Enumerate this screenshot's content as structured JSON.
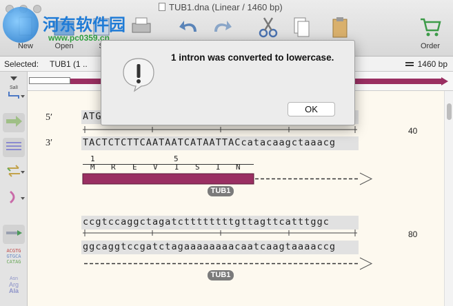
{
  "window": {
    "title": "TUB1.dna  (Linear / 1460 bp)"
  },
  "watermark": {
    "text": "河东软件园",
    "url": "www.pc0359.cn"
  },
  "toolbar": {
    "new_label": "New",
    "open_label": "Open",
    "save_label": "S",
    "order_label": "Order"
  },
  "selection": {
    "label": "Selected:",
    "value": "TUB1   (1 ..",
    "length": "1460 bp"
  },
  "sidebar": {
    "enzyme_label": "SalI",
    "seq_icon_lines": [
      "ACGTG",
      "GTGCA",
      "CATAG"
    ],
    "aa_icon_lines": [
      "Asn",
      "Arg",
      "Ala"
    ]
  },
  "sequence": {
    "five_prime": "5′",
    "three_prime": "3′",
    "row1_top": "ATG",
    "row1_top_tail": "c",
    "row1_bottom": "TACTCTCTTCAATAATCATAATTACcatacaagctaaacg",
    "row1_number": "40",
    "translation_numbers": [
      "1",
      "5"
    ],
    "translation": [
      "M",
      "R",
      "E",
      "V",
      "I",
      "S",
      "I",
      "N"
    ],
    "feature_label": "TUB1",
    "row2_top": "ccgtccaggctagatcttttttttgttagttcatttggc",
    "row2_bottom": "ggcaggtccgatctagaaaaaaaacaatcaagtaaaaccg",
    "row2_number": "80",
    "feature_label_2": "TUB1"
  },
  "dialog": {
    "message": "1 intron was converted to lowercase.",
    "ok_label": "OK"
  },
  "colors": {
    "feature": "#9a2f62",
    "sequence_bg": "#fdf9ef",
    "watermark_blue": "#1f7bd6",
    "watermark_green": "#2e9e3e"
  }
}
